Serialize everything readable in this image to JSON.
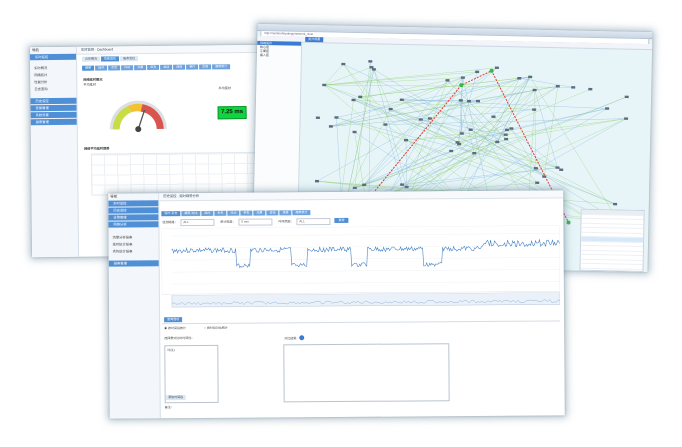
{
  "dashboard": {
    "sidebar_title": "导航",
    "sidebar_items": [
      "实时监控",
      "历史监控",
      "告警管理",
      "系统设置",
      "报表管理",
      "配置管理"
    ],
    "sidebar_subitems": [
      "实时概况",
      "网络拓扑",
      "性能分析",
      "日志查询"
    ],
    "breadcrumb": "实时监控 · Dashboard",
    "tabs_row1": [
      "总体概况",
      "性能监控",
      "服务监控"
    ],
    "tabs_row2": [
      "概要",
      "延时",
      "丢包",
      "抖动",
      "流量",
      "带宽",
      "会话",
      "连接",
      "事件",
      "告警",
      "趋势统计"
    ],
    "gauge_title": "网络延时概况",
    "gauge_sub": "平均延时",
    "metric_label": "平均延时",
    "metric_value": "7.25 ms",
    "trend_title": "网络平均延时趋势",
    "gauge_colors": {
      "green": "#c8dc46",
      "yellow": "#f2c233",
      "red": "#d9534f"
    }
  },
  "topology": {
    "address": "http://monitor/topology/network_view",
    "tree_items": [
      "网络拓扑",
      "核心层",
      "汇聚层",
      "接入层"
    ],
    "tab_label": "拓扑视图",
    "accent_path_color": "#e03a2a"
  },
  "timeseries": {
    "sidebar_items": [
      "实时监控",
      "历史监控",
      "告警管理",
      "网络分析",
      "报表管理",
      "配置管理",
      "系统设置"
    ],
    "sidebar_subitems": [
      "流量分析报表",
      "延时统计报表",
      "丢包统计报表"
    ],
    "breadcrumb": "历史监控 · 延时趋势分析",
    "tabs": [
      "延时·丢包",
      "趋势·对比",
      "延时",
      "丢包",
      "抖动",
      "带宽",
      "流量",
      "会话",
      "连接",
      "趋势统计"
    ],
    "filter_labels": [
      "监测链路：",
      "统计粒度：",
      "时间范围："
    ],
    "filter_values": [
      "ALL",
      "5 min",
      "ALL"
    ],
    "query_button": "查询",
    "options_tab": "查询选项",
    "radio_labels": [
      "按时间段统计",
      "按时段对比统计"
    ],
    "left_list_title": "选择要对比的时间段：",
    "left_list_first": "时段1",
    "add_button": "添加时间段",
    "right_box_title": "对比结果：",
    "note": "备注："
  }
}
